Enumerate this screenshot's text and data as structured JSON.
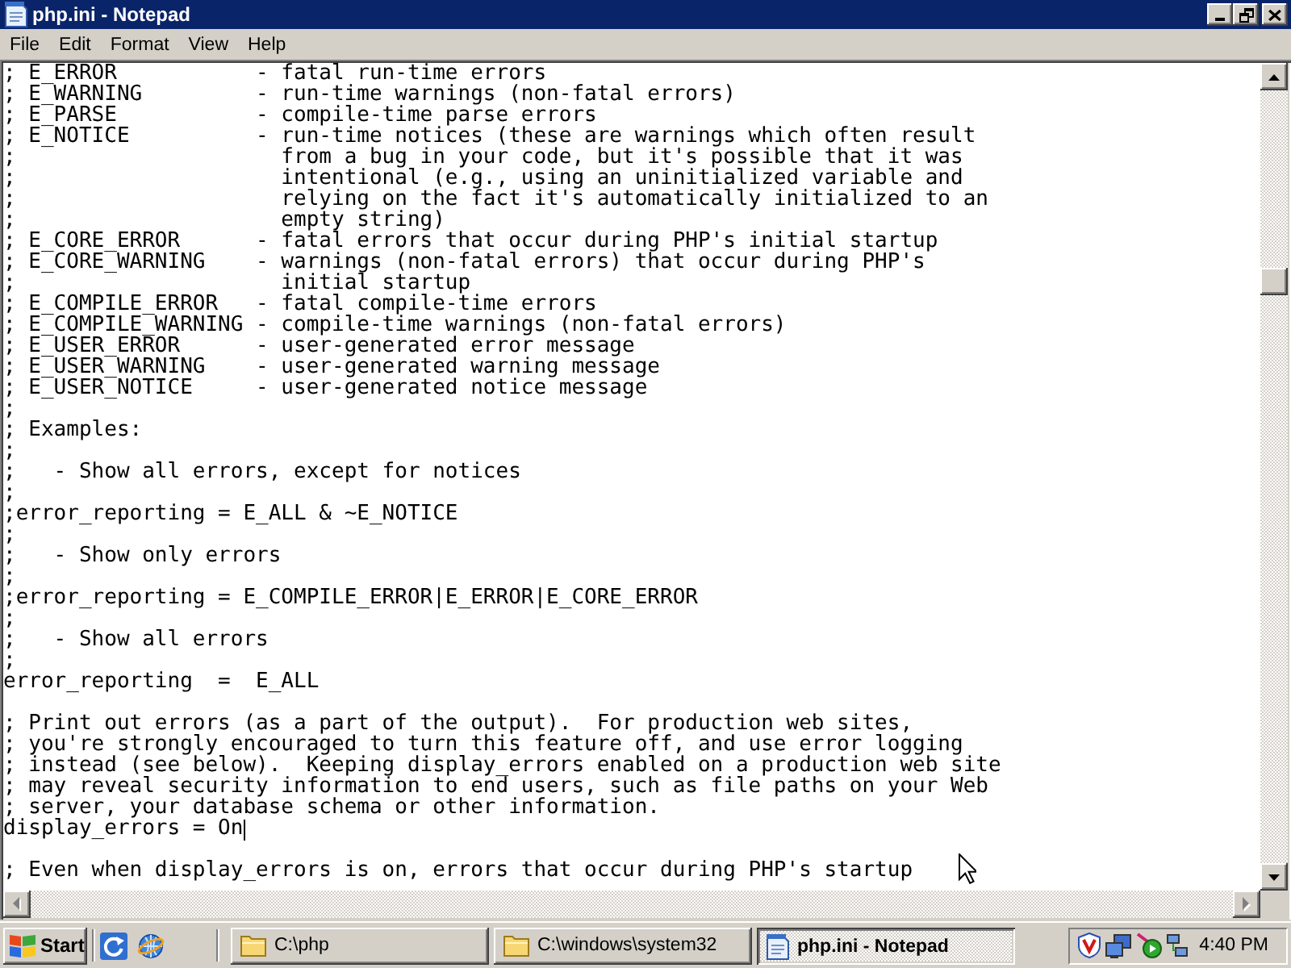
{
  "window": {
    "title": "php.ini - Notepad",
    "maximized": true
  },
  "menu_bar": [
    "File",
    "Edit",
    "Format",
    "View",
    "Help"
  ],
  "editor": {
    "blocks": [
      {
        "lines": [
          "; E_ERROR           - fatal run-time errors",
          "; E_WARNING         - run-time warnings (non-fatal errors)",
          "; E_PARSE           - compile-time parse errors",
          "; E_NOTICE          - run-time notices (these are warnings which often result",
          ";                     from a bug in your code, but it's possible that it was",
          ";                     intentional (e.g., using an uninitialized variable and",
          ";                     relying on the fact it's automatically initialized to an",
          ";                     empty string)",
          "; E_CORE_ERROR      - fatal errors that occur during PHP's initial startup",
          "; E_CORE_WARNING    - warnings (non-fatal errors) that occur during PHP's",
          ";                     initial startup",
          "; E_COMPILE_ERROR   - fatal compile-time errors",
          "; E_COMPILE_WARNING - compile-time warnings (non-fatal errors)",
          "; E_USER_ERROR      - user-generated error message",
          "; E_USER_WARNING    - user-generated warning message",
          "; E_USER_NOTICE     - user-generated notice message",
          ";",
          "; Examples:",
          ";",
          ";   - Show all errors, except for notices",
          ";",
          ";error_reporting = E_ALL & ~E_NOTICE",
          ";",
          ";   - Show only errors",
          ";",
          ";error_reporting = E_COMPILE_ERROR|E_ERROR|E_CORE_ERROR",
          ";",
          ";   - Show all errors",
          ";",
          "error_reporting  =  E_ALL"
        ],
        "caret_at_end": false
      },
      {
        "lines": [
          "; Print out errors (as a part of the output).  For production web sites,",
          "; you're strongly encouraged to turn this feature off, and use error logging",
          "; instead (see below).  Keeping display_errors enabled on a production web site",
          "; may reveal security information to end users, such as file paths on your Web",
          "; server, your database schema or other information.",
          "display_errors = On"
        ],
        "caret_at_end": true
      },
      {
        "lines": [
          "; Even when display_errors is on, errors that occur during PHP's startup"
        ],
        "caret_at_end": false
      }
    ]
  },
  "taskbar": {
    "start": "Start",
    "tasks": [
      {
        "label": "C:\\php",
        "kind": "folder",
        "selected": false
      },
      {
        "label": "C:\\windows\\system32",
        "kind": "folder",
        "selected": false
      },
      {
        "label": "php.ini - Notepad",
        "kind": "notepad",
        "selected": true
      }
    ],
    "clock": "4:40 PM"
  }
}
